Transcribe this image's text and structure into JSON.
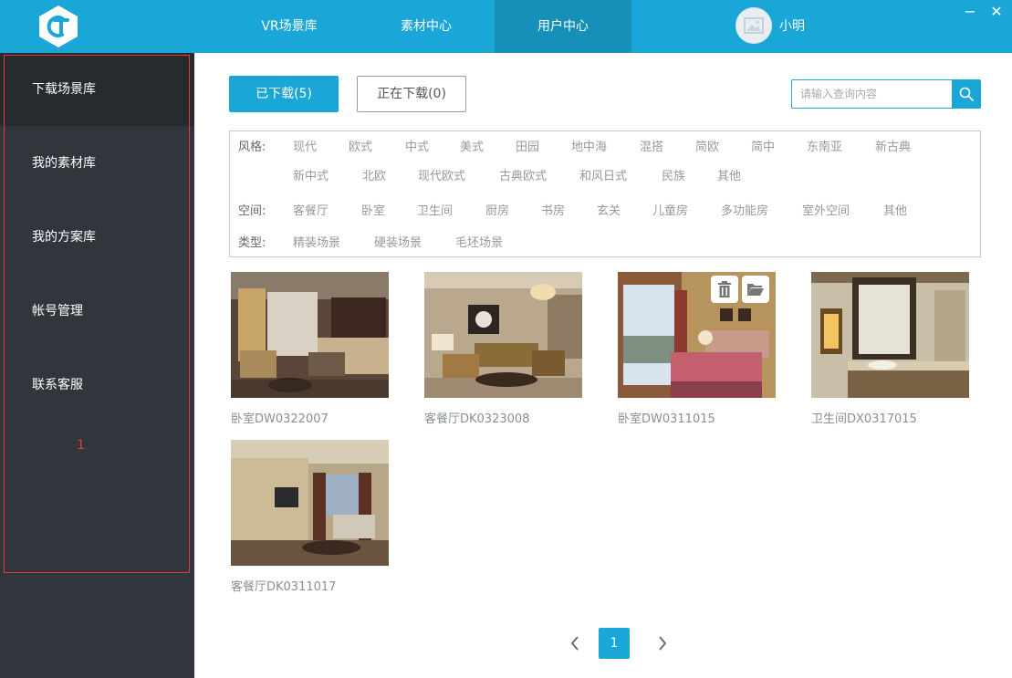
{
  "header": {
    "nav": [
      {
        "label": "VR场景库"
      },
      {
        "label": "素材中心"
      },
      {
        "label": "用户中心"
      }
    ],
    "user": {
      "name": "小明"
    },
    "controls": {
      "minimize": "−",
      "close": "✕"
    }
  },
  "sidebar": {
    "items": [
      {
        "label": "下载场景库"
      },
      {
        "label": "我的素材库"
      },
      {
        "label": "我的方案库"
      },
      {
        "label": "帐号管理"
      },
      {
        "label": "联系客服"
      }
    ],
    "annotation": "1"
  },
  "tabs": {
    "downloaded": "已下载(5)",
    "downloading": "正在下载(0)"
  },
  "search": {
    "placeholder": "请输入查询内容"
  },
  "filters": {
    "style_label": "风格:",
    "style_row1": [
      "现代",
      "欧式",
      "中式",
      "美式",
      "田园",
      "地中海",
      "混搭",
      "简欧",
      "简中",
      "东南亚",
      "新古典"
    ],
    "style_row2": [
      "新中式",
      "北欧",
      "现代欧式",
      "古典欧式",
      "和风日式",
      "民族",
      "其他"
    ],
    "space_label": "空间:",
    "space": [
      "客餐厅",
      "卧室",
      "卫生间",
      "厨房",
      "书房",
      "玄关",
      "儿童房",
      "多功能房",
      "室外空间",
      "其他"
    ],
    "type_label": "类型:",
    "type": [
      "精装场景",
      "硬装场景",
      "毛坯场景"
    ]
  },
  "scenes": [
    {
      "name": "卧室DW0322007"
    },
    {
      "name": "客餐厅DK0323008"
    },
    {
      "name": "卧室DW0311015"
    },
    {
      "name": "卫生间DX0317015"
    },
    {
      "name": "客餐厅DK0311017"
    }
  ],
  "pagination": {
    "current": "1"
  },
  "colors": {
    "accent": "#1aa6d6",
    "sidebar": "#30363c",
    "annotation": "#e23b3b"
  }
}
